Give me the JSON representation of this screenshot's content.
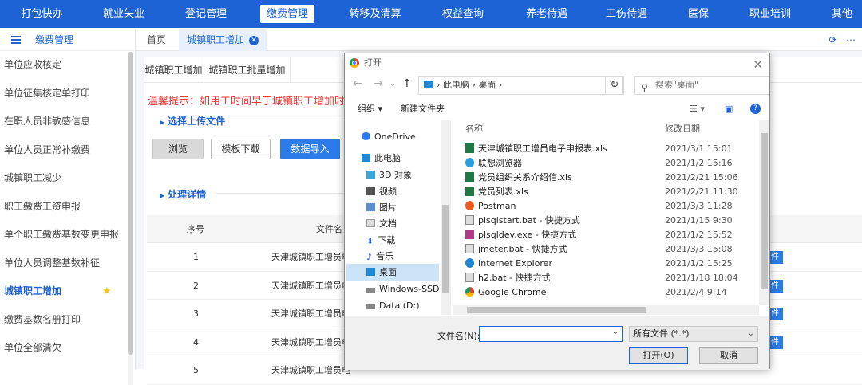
{
  "topnav": {
    "items": [
      "打包快办",
      "就业失业",
      "登记管理",
      "缴费管理",
      "转移及清算",
      "权益查询",
      "养老待遇",
      "工伤待遇",
      "医保",
      "职业培训",
      "其他"
    ],
    "active": "缴费管理"
  },
  "sidebar": {
    "title": "缴费管理",
    "items": [
      "单位应收核定",
      "单位征集核定单打印",
      "在职人员非敏感信息",
      "单位人员正常补缴费",
      "城镇职工减少",
      "职工缴费工资申报",
      "单个职工缴费基数变更申报",
      "单位人员调整基数补征",
      "城镇职工增加",
      "缴费基数名册打印",
      "单位全部清欠"
    ],
    "active": "城镇职工增加"
  },
  "tabs": {
    "home": "首页",
    "current": "城镇职工增加"
  },
  "subtabs": [
    "城镇职工增加",
    "城镇职工批量增加"
  ],
  "warning": "温馨提示：如用工时间早于城镇职工增加时间",
  "sections": {
    "upload": "选择上传文件",
    "detail": "处理详情"
  },
  "buttons": {
    "browse": "浏览",
    "template": "模板下载",
    "import": "数据导入"
  },
  "table": {
    "headers": [
      "序号",
      "文件名"
    ],
    "rows": [
      {
        "idx": "1",
        "file": "天津城镇职工增员电"
      },
      {
        "idx": "2",
        "file": "天津城镇职工增员电"
      },
      {
        "idx": "3",
        "file": "天津城镇职工增员电"
      },
      {
        "idx": "4",
        "file": "天津城镇职工增员电"
      },
      {
        "idx": "5",
        "file": "天津城镇职工增员电"
      }
    ],
    "row_button": "件"
  },
  "dialog": {
    "title": "打开",
    "path": [
      "此电脑",
      "桌面"
    ],
    "search_placeholder": "搜索\"桌面\"",
    "organize": "组织",
    "new_folder": "新建文件夹",
    "tree": [
      {
        "label": "OneDrive",
        "icon": "cloud-icon"
      },
      {
        "label": "此电脑",
        "icon": "computer-icon"
      },
      {
        "label": "3D 对象",
        "icon": "3d-objects-icon"
      },
      {
        "label": "视频",
        "icon": "video-icon"
      },
      {
        "label": "图片",
        "icon": "picture-icon"
      },
      {
        "label": "文档",
        "icon": "document-icon"
      },
      {
        "label": "下载",
        "icon": "download-icon"
      },
      {
        "label": "音乐",
        "icon": "music-icon"
      },
      {
        "label": "桌面",
        "icon": "desktop-icon"
      },
      {
        "label": "Windows-SSD (",
        "icon": "drive-icon"
      },
      {
        "label": "Data (D:)",
        "icon": "drive-icon"
      }
    ],
    "tree_selected": "桌面",
    "columns": {
      "name": "名称",
      "date": "修改日期"
    },
    "files": [
      {
        "name": "天津城镇职工增员电子申报表.xls",
        "date": "2021/3/1 15:01",
        "icon": "excel-icon"
      },
      {
        "name": "联想浏览器",
        "date": "2021/1/2 15:16",
        "icon": "browser-icon"
      },
      {
        "name": "党员组织关系介绍信.xls",
        "date": "2021/2/21 15:06",
        "icon": "excel-icon"
      },
      {
        "name": "党员列表.xls",
        "date": "2021/2/21 11:30",
        "icon": "excel-icon"
      },
      {
        "name": "Postman",
        "date": "2021/3/3 11:28",
        "icon": "postman-icon"
      },
      {
        "name": "plsqlstart.bat - 快捷方式",
        "date": "2021/1/15 9:30",
        "icon": "shortcut-icon"
      },
      {
        "name": "plsqldev.exe - 快捷方式",
        "date": "2021/1/2 15:52",
        "icon": "shortcut-icon"
      },
      {
        "name": "jmeter.bat - 快捷方式",
        "date": "2021/3/3 15:08",
        "icon": "shortcut-icon"
      },
      {
        "name": "Internet Explorer",
        "date": "2021/1/2 15:25",
        "icon": "ie-icon"
      },
      {
        "name": "h2.bat - 快捷方式",
        "date": "2021/1/18 18:04",
        "icon": "shortcut-icon"
      },
      {
        "name": "Google Chrome",
        "date": "2021/2/4 9:14",
        "icon": "chrome-icon"
      }
    ],
    "filename_label": "文件名(N):",
    "filename_value": "",
    "filetype": "所有文件 (*.*)",
    "open_btn": "打开(O)",
    "cancel_btn": "取消"
  },
  "colors": {
    "brand": "#1e63d6",
    "warning": "#e33333",
    "button_blue": "#2b7ce8"
  }
}
